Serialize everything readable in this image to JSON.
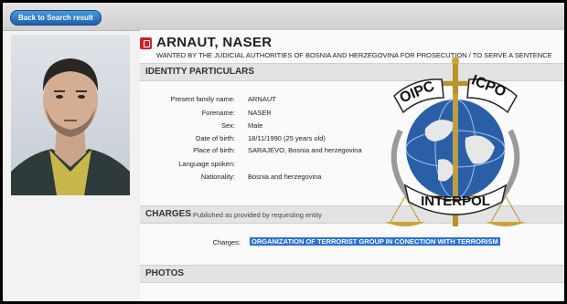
{
  "topbar": {
    "back_label": "Back to Search result"
  },
  "profile": {
    "name": "ARNAUT, NASER",
    "wanted_text": "WANTED BY THE JUDICIAL AUTHORITIES OF BOSNIA AND HERZEGOVINA FOR PROSECUTION / TO SERVE A SENTENCE"
  },
  "identity": {
    "title": "IDENTITY PARTICULARS",
    "fields": [
      {
        "label": "Present family name:",
        "value": "ARNAUT"
      },
      {
        "label": "Forename:",
        "value": "NASER"
      },
      {
        "label": "Sex:",
        "value": "Male"
      },
      {
        "label": "Date of birth:",
        "value": "18/11/1990 (25 years old)"
      },
      {
        "label": "Place of birth:",
        "value": "SARAJEVO, Bosnia and herzegovina"
      },
      {
        "label": "Language spoken:",
        "value": ""
      },
      {
        "label": "Nationality:",
        "value": "Bosnia and herzegovina"
      }
    ]
  },
  "charges": {
    "title": "CHARGES",
    "subtitle": "Published as provided by requesting entity",
    "label": "Charges:",
    "value": "ORGANIZATION OF TERRORIST GROUP IN CONECTION WITH TERRORISM"
  },
  "photos": {
    "title": "PHOTOS"
  },
  "emblem": {
    "top_left": "OIPC",
    "top_right": "ICPO",
    "bottom": "INTERPOL"
  },
  "colors": {
    "highlight": "#2a6fd6",
    "button": "#1b5fa8",
    "brand_red": "#d01f25",
    "globe": "#2a5fa8"
  }
}
